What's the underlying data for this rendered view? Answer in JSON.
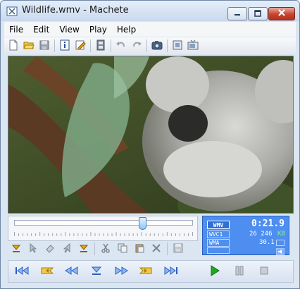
{
  "window": {
    "title": "Wildlife.wmv - Machete"
  },
  "menu": {
    "items": [
      "File",
      "Edit",
      "View",
      "Play",
      "Help"
    ]
  },
  "toolbar": {
    "icons": [
      "new-file-icon",
      "open-folder-icon",
      "save-icon",
      "info-icon",
      "edit-tags-icon",
      "film-icon",
      "undo-icon",
      "redo-icon",
      "snapshot-icon",
      "frame-icon",
      "tv-icon"
    ]
  },
  "edit_toolbar": {
    "icons": [
      "set-start-marker-icon",
      "select-icon",
      "erase-icon",
      "cut-marker-icon",
      "set-end-marker-icon",
      "cut-icon",
      "copy-icon",
      "paste-icon",
      "delete-icon",
      "save-disabled-icon"
    ]
  },
  "seek": {
    "position_fraction": 0.72
  },
  "info_panel": {
    "format": "WMV",
    "time": "0:21.9",
    "video_codec": "WVC1",
    "audio_codec": "WMA",
    "bitrate": "26 246",
    "bitrate_unit": "KB",
    "fps": "30.1"
  },
  "transport": {
    "icons": [
      "go-start-icon",
      "prev-marker-icon",
      "rewind-icon",
      "set-marker-icon",
      "fast-forward-icon",
      "next-marker-icon",
      "go-end-icon",
      "play-icon",
      "pause-icon",
      "stop-icon"
    ]
  },
  "colors": {
    "info_panel": "#4d8ef0",
    "play_green": "#1fa81f",
    "marker_orange": "#e8a317",
    "nav_blue": "#2b5fc2"
  }
}
